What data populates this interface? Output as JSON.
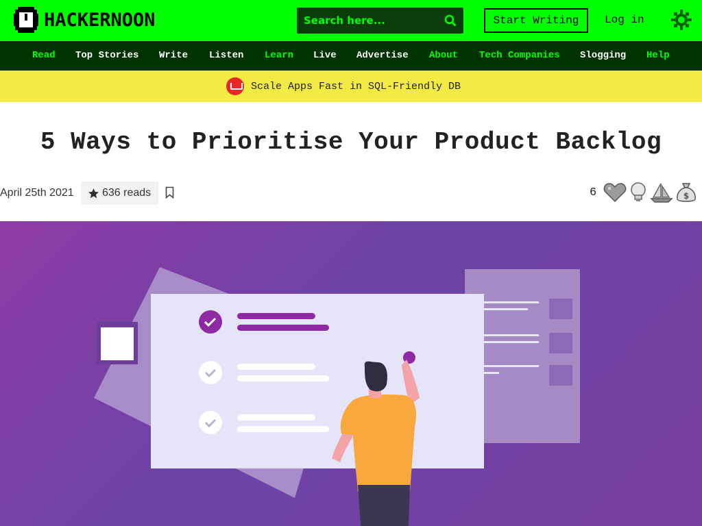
{
  "header": {
    "logo_text": "HACKERNOON",
    "search_placeholder": "Search here...",
    "start_writing": "Start Writing",
    "login": "Log in"
  },
  "nav": [
    {
      "label": "Read",
      "color": "#00ff00"
    },
    {
      "label": "Top Stories",
      "color": "#ffffff"
    },
    {
      "label": "Write",
      "color": "#ffffff"
    },
    {
      "label": "Listen",
      "color": "#ffffff"
    },
    {
      "label": "Learn",
      "color": "#00ff00"
    },
    {
      "label": "Live",
      "color": "#ffffff"
    },
    {
      "label": "Advertise",
      "color": "#ffffff"
    },
    {
      "label": "About",
      "color": "#00ff00"
    },
    {
      "label": "Tech Companies",
      "color": "#00ff00"
    },
    {
      "label": "Slogging",
      "color": "#ffffff"
    },
    {
      "label": "Help",
      "color": "#00ff00"
    }
  ],
  "promo": {
    "text": "Scale Apps Fast in SQL-Friendly DB",
    "icon": "couchbase-icon"
  },
  "article": {
    "title": "5 Ways to Prioritise Your Product Backlog",
    "date": "April 25th 2021",
    "reads": "636 reads",
    "reaction_count": "6"
  },
  "reactions": [
    "heart-icon",
    "lightbulb-icon",
    "boat-icon",
    "money-bag-icon"
  ],
  "colors": {
    "brand_green": "#00ff00",
    "nav_bg": "#003300",
    "promo_bg": "#f4ea44",
    "hero_purple": "#7a3ea0"
  }
}
